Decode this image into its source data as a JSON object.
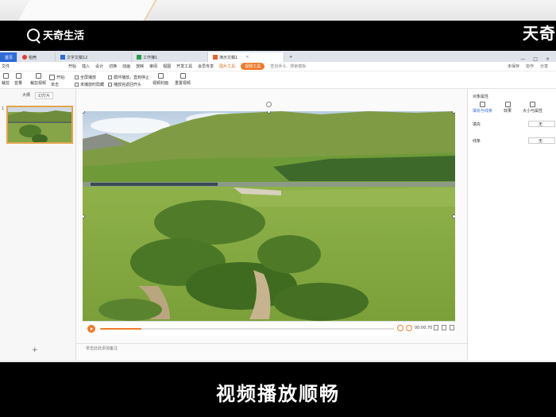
{
  "overlay": {
    "logo_text": "天奇生活",
    "brand_right": "天奇",
    "caption": "视频播放顺畅"
  },
  "tabs": [
    {
      "label": "首页"
    },
    {
      "label": "稻壳"
    },
    {
      "label": "文字文稿12"
    },
    {
      "label": "工作簿1"
    },
    {
      "label": "演示文稿1"
    }
  ],
  "menu": {
    "file": "文件",
    "items": [
      "开始",
      "插入",
      "设计",
      "切换",
      "动画",
      "放映",
      "审阅",
      "视图",
      "开发工具",
      "会员专享"
    ],
    "picture_tools": "图片工具",
    "video_tools": "视频工具",
    "search": "查找命令、搜索模板",
    "right": [
      "未保存",
      "协作",
      "分享"
    ]
  },
  "ribbon": {
    "crop": "裁剪",
    "volume": "音量",
    "clip_video": "裁剪视频",
    "start_label": "开始:",
    "start_value": "单击",
    "fullscreen": "全屏播放",
    "loop": "循环播放，直到停止",
    "auto_hide": "未播放时隐藏",
    "rewind": "播放完返回开头",
    "cover": "视频封面",
    "reset": "重置视频"
  },
  "left_panel": {
    "tab_outline": "大纲",
    "tab_slides": "幻灯片",
    "slide_number": "1",
    "add": "+"
  },
  "player": {
    "time": "00:00.70",
    "progress": 0.14
  },
  "notes": {
    "placeholder": "单击此处添加备注"
  },
  "right_panel": {
    "title": "对象属性",
    "tabs": [
      "填充与线条",
      "效果",
      "大小与属性"
    ],
    "fill_label": "填充",
    "fill_value": "无",
    "line_label": "线条",
    "line_value": "无"
  }
}
